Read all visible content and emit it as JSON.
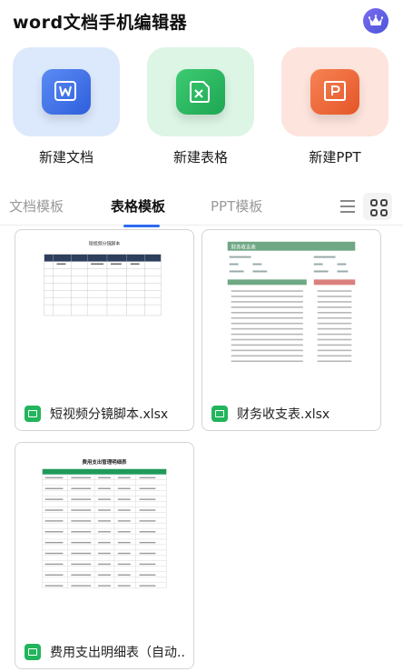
{
  "header": {
    "title": "word文档手机编辑器"
  },
  "create": [
    {
      "label": "新建文档",
      "glyph": "W",
      "tile_color": "#dce9fc",
      "icon_color": "#3f73e8"
    },
    {
      "label": "新建表格",
      "glyph": "X",
      "tile_color": "#dcf5e5",
      "icon_color": "#26b35a"
    },
    {
      "label": "新建PPT",
      "glyph": "P",
      "tile_color": "#fde4dc",
      "icon_color": "#ef6a3e"
    }
  ],
  "tabs": [
    {
      "label": "文档模板",
      "active": false
    },
    {
      "label": "表格模板",
      "active": true
    },
    {
      "label": "PPT模板",
      "active": false
    }
  ],
  "templates": [
    {
      "name": "短视频分镜脚本.xlsx",
      "icon": "excel-icon"
    },
    {
      "name": "财务收支表.xlsx",
      "icon": "excel-icon"
    },
    {
      "name": "费用支出明细表（自动..",
      "icon": "excel-icon"
    }
  ],
  "thumbnails": {
    "storyboard_title": "短视频分镜脚本",
    "finance_title": "财务收支表",
    "expense_title": "费用支出管理明细表"
  },
  "colors": {
    "accent": "#2f6bf0",
    "finance_header": "#6fa884",
    "expense_header": "#1f9a5a",
    "excel": "#22b55c"
  }
}
